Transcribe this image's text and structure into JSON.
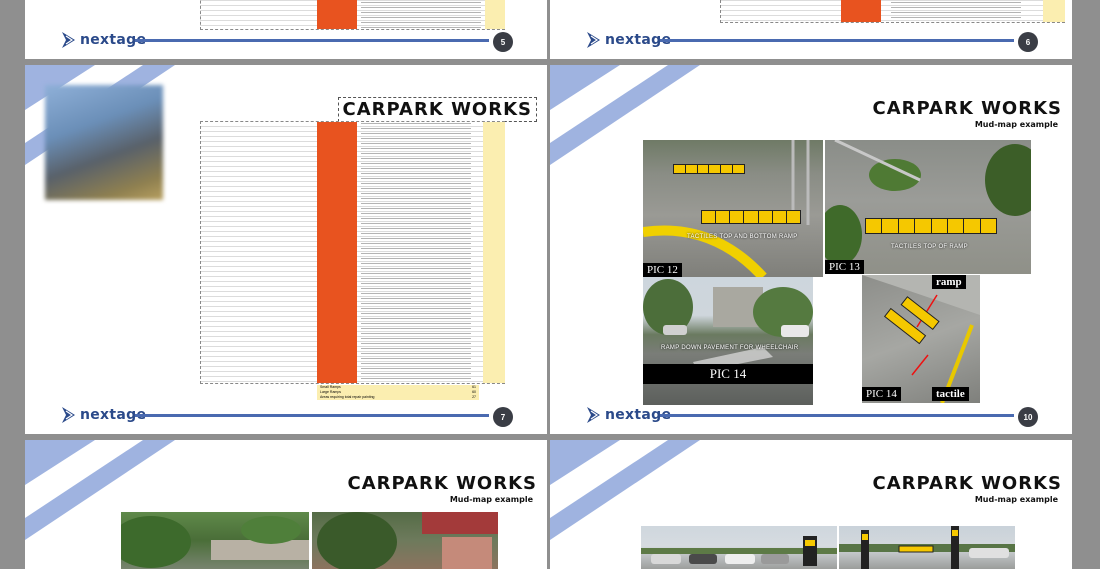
{
  "slides": {
    "s5": {
      "page": "5"
    },
    "s6": {
      "page": "6"
    },
    "s7": {
      "page": "7",
      "title": "CARPARK WORKS",
      "summary": [
        {
          "label": "Small Ramps",
          "value": "61"
        },
        {
          "label": "Large Ramps",
          "value": "60"
        },
        {
          "label": "Areas requiring total repair painting",
          "value": "27"
        }
      ]
    },
    "s10": {
      "page": "10",
      "title": "CARPARK WORKS",
      "subtitle": "Mud-map example",
      "photos": {
        "pic12": {
          "label": "PIC 12",
          "caption": "TACTILES TOP AND BOTTOM RAMP"
        },
        "pic13": {
          "label": "PIC 13",
          "caption": "TACTILES TOP OF RAMP"
        },
        "pic14a": {
          "label": "PIC 14",
          "caption": "RAMP DOWN PAVEMENT FOR WHEELCHAIR"
        },
        "pic14b": {
          "label": "PIC 14",
          "ramp": "ramp",
          "tactile": "tactile"
        }
      }
    },
    "s11": {
      "title": "CARPARK WORKS",
      "subtitle": "Mud-map example"
    },
    "s12": {
      "title": "CARPARK WORKS",
      "subtitle": "Mud-map example"
    }
  },
  "brand": {
    "name": "nextage",
    "accent": "#4a6ab0",
    "stripe": "#9fb3e0",
    "highlight": "#e8531f"
  },
  "icons": {
    "logo": "nextage-chevron-icon"
  }
}
